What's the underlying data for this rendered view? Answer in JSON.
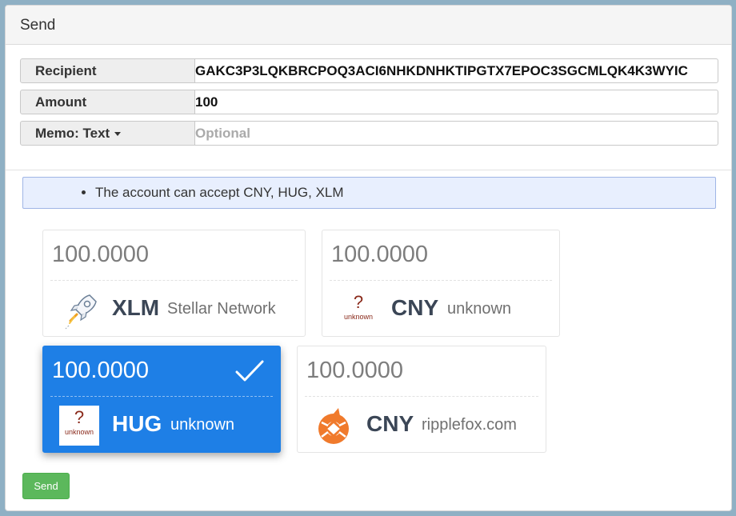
{
  "panel": {
    "title": "Send"
  },
  "form": {
    "recipient": {
      "label": "Recipient",
      "value": "GAKC3P3LQKBRCPOQ3ACI6NHKDNHKTIPGTX7EPOC3SGCMLQK4K3WYIC"
    },
    "amount": {
      "label": "Amount",
      "value": "100"
    },
    "memo": {
      "label": "Memo: Text",
      "placeholder": "Optional"
    }
  },
  "alert": {
    "text": "The account can accept CNY, HUG, XLM"
  },
  "assets": [
    {
      "amount": "100.0000",
      "code": "XLM",
      "issuer": "Stellar Network",
      "icon": "stellar-rocket-icon",
      "selected": false
    },
    {
      "amount": "100.0000",
      "code": "CNY",
      "issuer": "unknown",
      "icon": "unknown-asset-icon",
      "icon_q": "?",
      "icon_text": "unknown",
      "selected": false
    },
    {
      "amount": "100.0000",
      "code": "HUG",
      "issuer": "unknown",
      "icon": "unknown-asset-icon",
      "icon_q": "?",
      "icon_text": "unknown",
      "selected": true
    },
    {
      "amount": "100.0000",
      "code": "CNY",
      "issuer": "ripplefox.com",
      "icon": "ripplefox-logo-icon",
      "selected": false
    }
  ],
  "send_button": {
    "label": "Send"
  },
  "colors": {
    "selected": "#1e7fe6",
    "send": "#5cb85c",
    "alert_bg": "#e8effe"
  }
}
